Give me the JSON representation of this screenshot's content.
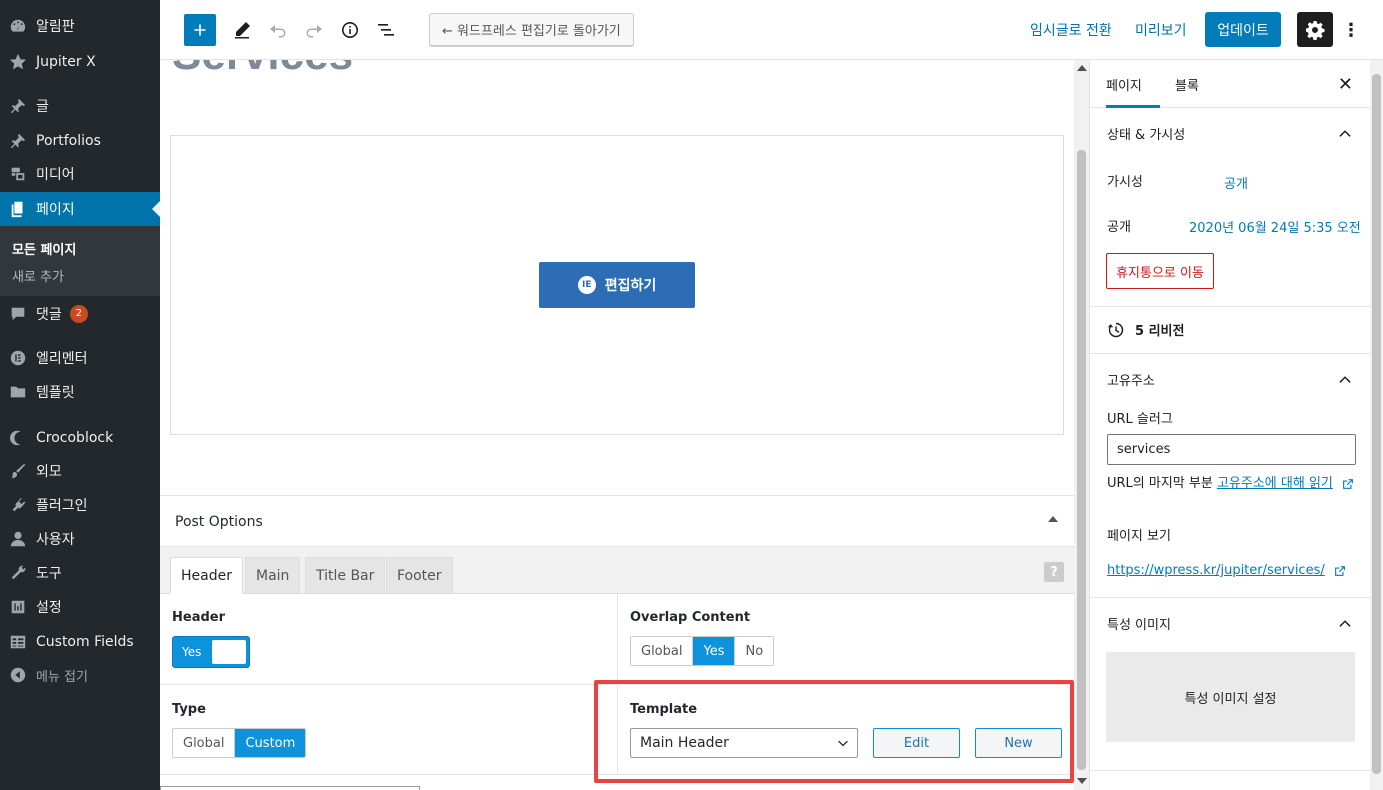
{
  "admin_menu": {
    "items": [
      {
        "label": "알림판",
        "icon": "dashboard-icon"
      },
      {
        "label": "Jupiter X",
        "icon": "star-icon"
      },
      {
        "label": "글",
        "icon": "pin-icon"
      },
      {
        "label": "Portfolios",
        "icon": "pin-icon"
      },
      {
        "label": "미디어",
        "icon": "media-icon"
      },
      {
        "label": "페이지",
        "icon": "pages-icon"
      },
      {
        "label": "댓글",
        "icon": "comment-icon",
        "badge": "2"
      },
      {
        "label": "엘리멘터",
        "icon": "elementor-icon"
      },
      {
        "label": "템플릿",
        "icon": "folder-icon"
      },
      {
        "label": "Crocoblock",
        "icon": "crocoblock-icon"
      },
      {
        "label": "외모",
        "icon": "brush-icon"
      },
      {
        "label": "플러그인",
        "icon": "plugin-icon"
      },
      {
        "label": "사용자",
        "icon": "user-icon"
      },
      {
        "label": "도구",
        "icon": "wrench-icon"
      },
      {
        "label": "설정",
        "icon": "settings-sliders-icon"
      },
      {
        "label": "Custom Fields",
        "icon": "table-icon"
      },
      {
        "label": "메뉴 접기",
        "icon": "collapse-icon"
      }
    ],
    "submenu": [
      "모든 페이지",
      "새로 추가"
    ]
  },
  "toolbar": {
    "back_label": "← 워드프레스 편집기로 돌아가기",
    "switch_draft": "임시글로 전환",
    "preview": "미리보기",
    "update": "업데이트",
    "more": "⋮"
  },
  "content": {
    "page_title": "Services",
    "elementor_button": "편집하기",
    "elementor_logo": "IE"
  },
  "post_options": {
    "title": "Post Options",
    "tabs": [
      "Header",
      "Main",
      "Title Bar",
      "Footer"
    ],
    "help": "?",
    "header_label": "Header",
    "header_toggle": "Yes",
    "overlap_label": "Overlap Content",
    "overlap_options": [
      "Global",
      "Yes",
      "No"
    ],
    "overlap_selected": "Yes",
    "type_label": "Type",
    "type_options": [
      "Global",
      "Custom"
    ],
    "type_selected": "Custom",
    "template_label": "Template",
    "template_value": "Main Header",
    "edit_button": "Edit",
    "new_button": "New"
  },
  "sidebar": {
    "tab_page": "페이지",
    "tab_block": "블록",
    "close": "✕",
    "status_title": "상태 & 가시성",
    "visibility_label": "가시성",
    "visibility_value": "공개",
    "publish_label": "공개",
    "publish_value": "2020년 06월 24일 5:35 오전",
    "trash": "휴지통으로 이동",
    "revisions": "5 리비전",
    "permalink_title": "고유주소",
    "url_slug_label": "URL 슬러그",
    "url_slug_value": "services",
    "url_hint": "URL의 마지막 부분",
    "url_hint_link": "고유주소에 대해 읽기",
    "view_page_label": "페이지 보기",
    "page_url": "https://wpress.kr/jupiter/services/",
    "featured_title": "특성 이미지",
    "featured_set": "특성 이미지 설정"
  },
  "colors": {
    "admin_bg": "#23282d",
    "accent": "#007cba",
    "option_accent": "#0c93dc",
    "highlight": "#e74545"
  }
}
